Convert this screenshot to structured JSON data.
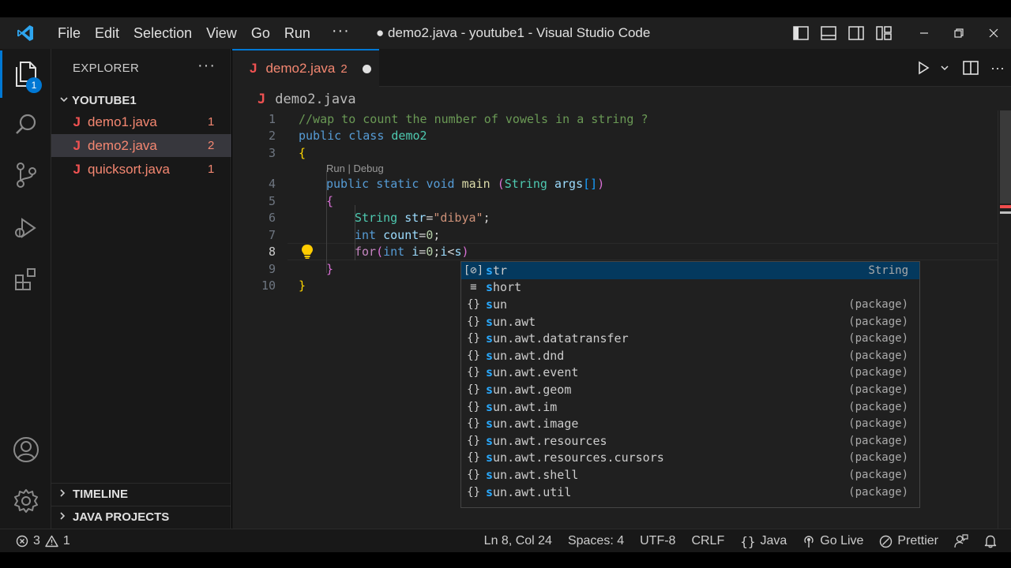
{
  "window": {
    "title": "● demo2.java - youtube1 - Visual Studio Code"
  },
  "menu": {
    "items": [
      "File",
      "Edit",
      "Selection",
      "View",
      "Go",
      "Run"
    ],
    "more": "···"
  },
  "activity": {
    "explorer_badge": "1"
  },
  "sidebar": {
    "header": "EXPLORER",
    "more": "···",
    "folder": "YOUTUBE1",
    "files": [
      {
        "icon": "J",
        "name": "demo1.java",
        "count": "1"
      },
      {
        "icon": "J",
        "name": "demo2.java",
        "count": "2"
      },
      {
        "icon": "J",
        "name": "quicksort.java",
        "count": "1"
      }
    ],
    "panels": [
      "TIMELINE",
      "JAVA PROJECTS"
    ]
  },
  "tab": {
    "icon": "J",
    "label": "demo2.java",
    "count": "2"
  },
  "breadcrumb": {
    "icon": "J",
    "label": "demo2.java"
  },
  "code": {
    "line_numbers": [
      "1",
      "2",
      "3",
      "4",
      "5",
      "6",
      "7",
      "8",
      "9",
      "10"
    ],
    "codelens": "Run | Debug",
    "l1": "//wap to count the number of vowels in a string ?",
    "l2_kw1": "public",
    "l2_kw2": "class",
    "l2_name": "demo2",
    "l3": "{",
    "l4_kw1": "public",
    "l4_kw2": "static",
    "l4_kw3": "void",
    "l4_fn": "main",
    "l4_open": "(",
    "l4_type": "String",
    "l4_var": "args",
    "l4_brackets": "[]",
    "l4_close": ")",
    "l5": "{",
    "l6_type": "String",
    "l6_var": "str",
    "l6_eq": "=",
    "l6_str": "\"dibya\"",
    "l6_semi": ";",
    "l7_kw": "int",
    "l7_var": "count",
    "l7_eq": "=",
    "l7_num": "0",
    "l7_semi": ";",
    "l8_kw": "for",
    "l8_open": "(",
    "l8_kw2": "int",
    "l8_var": "i",
    "l8_eq": "=",
    "l8_num": "0",
    "l8_semi": ";",
    "l8_var2": "i",
    "l8_lt": "<",
    "l8_var3": "s",
    "l8_close": ")",
    "l9": "}",
    "l10": "}"
  },
  "suggest": {
    "items": [
      {
        "icon": "variable-icon",
        "glyph": "[⊘]",
        "match": "s",
        "rest": "tr",
        "detail": "String"
      },
      {
        "icon": "keyword-icon",
        "glyph": "≡",
        "match": "s",
        "rest": "hort",
        "detail": ""
      },
      {
        "icon": "package-icon",
        "glyph": "{}",
        "match": "s",
        "rest": "un",
        "detail": "(package)"
      },
      {
        "icon": "package-icon",
        "glyph": "{}",
        "match": "s",
        "rest": "un.awt",
        "detail": "(package)"
      },
      {
        "icon": "package-icon",
        "glyph": "{}",
        "match": "s",
        "rest": "un.awt.datatransfer",
        "detail": "(package)"
      },
      {
        "icon": "package-icon",
        "glyph": "{}",
        "match": "s",
        "rest": "un.awt.dnd",
        "detail": "(package)"
      },
      {
        "icon": "package-icon",
        "glyph": "{}",
        "match": "s",
        "rest": "un.awt.event",
        "detail": "(package)"
      },
      {
        "icon": "package-icon",
        "glyph": "{}",
        "match": "s",
        "rest": "un.awt.geom",
        "detail": "(package)"
      },
      {
        "icon": "package-icon",
        "glyph": "{}",
        "match": "s",
        "rest": "un.awt.im",
        "detail": "(package)"
      },
      {
        "icon": "package-icon",
        "glyph": "{}",
        "match": "s",
        "rest": "un.awt.image",
        "detail": "(package)"
      },
      {
        "icon": "package-icon",
        "glyph": "{}",
        "match": "s",
        "rest": "un.awt.resources",
        "detail": "(package)"
      },
      {
        "icon": "package-icon",
        "glyph": "{}",
        "match": "s",
        "rest": "un.awt.resources.cursors",
        "detail": "(package)"
      },
      {
        "icon": "package-icon",
        "glyph": "{}",
        "match": "s",
        "rest": "un.awt.shell",
        "detail": "(package)"
      },
      {
        "icon": "package-icon",
        "glyph": "{}",
        "match": "s",
        "rest": "un.awt.util",
        "detail": "(package)"
      }
    ]
  },
  "status": {
    "errors": "3",
    "warnings": "1",
    "position": "Ln 8, Col 24",
    "spaces": "Spaces: 4",
    "encoding": "UTF-8",
    "eol": "CRLF",
    "language": "Java",
    "golive": "Go Live",
    "prettier": "Prettier"
  },
  "colors": {
    "accent": "#0078d4",
    "error_file": "#f48771",
    "java_icon": "#f05252"
  }
}
